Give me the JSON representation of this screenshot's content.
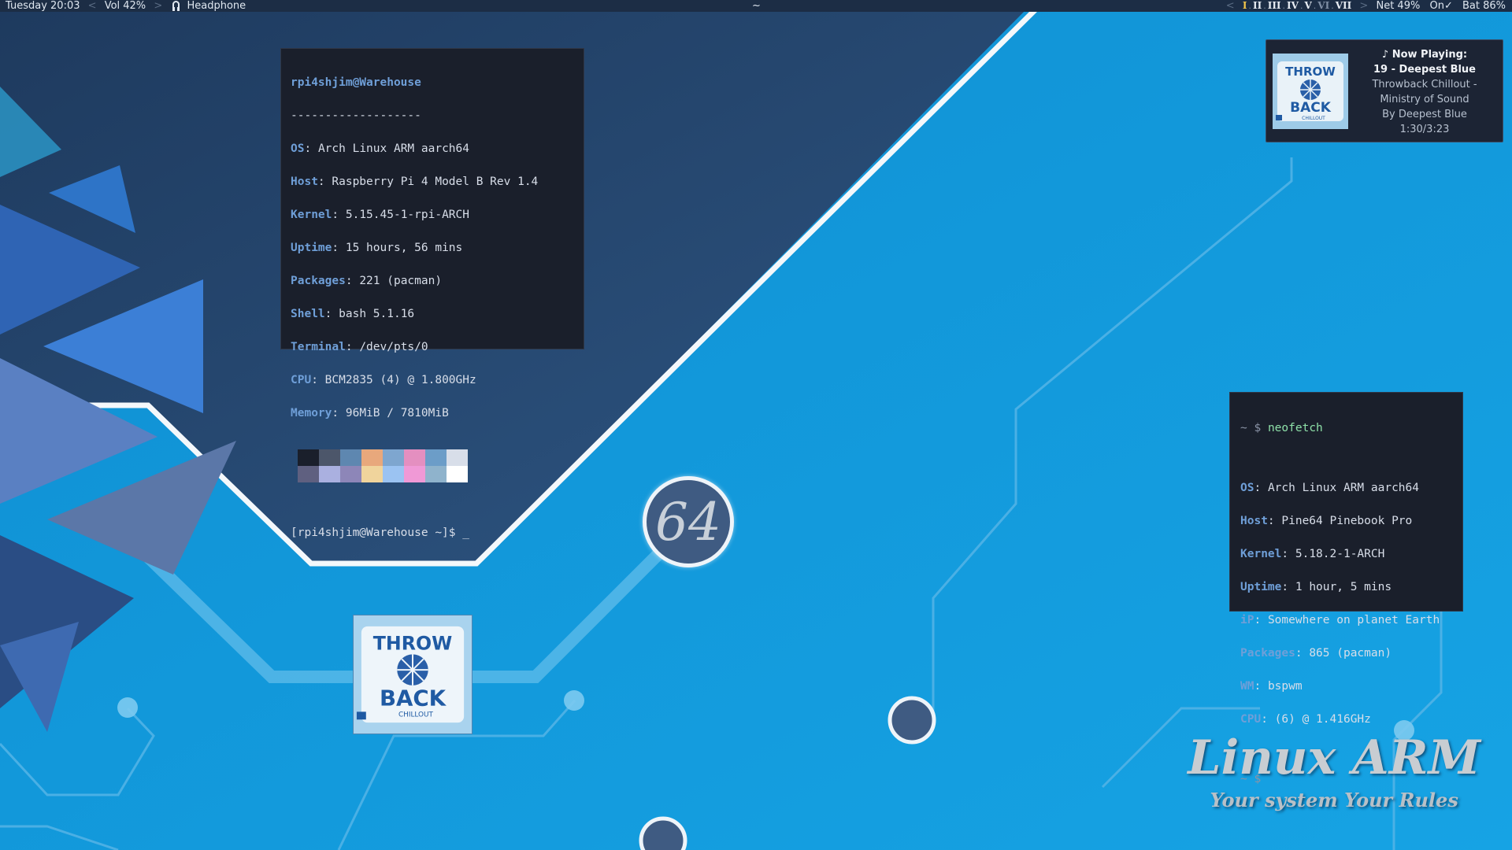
{
  "topbar": {
    "day": "Tuesday",
    "time": "20:03",
    "volume": "Vol 42%",
    "audio_device": "Headphone",
    "center_title": "~",
    "workspaces": [
      "I",
      "II",
      "III",
      "IV",
      "V",
      "VI",
      "VII"
    ],
    "active_workspace": "I",
    "network": "Net 49%",
    "status": "On✓",
    "battery": "Bat 86%"
  },
  "terminal_left": {
    "user_host": "rpi4shjim@Warehouse",
    "divider": "-------------------",
    "rows": [
      {
        "key": "OS",
        "value": "Arch Linux ARM aarch64"
      },
      {
        "key": "Host",
        "value": "Raspberry Pi 4 Model B Rev 1.4"
      },
      {
        "key": "Kernel",
        "value": "5.15.45-1-rpi-ARCH"
      },
      {
        "key": "Uptime",
        "value": "15 hours, 56 mins"
      },
      {
        "key": "Packages",
        "value": "221 (pacman)"
      },
      {
        "key": "Shell",
        "value": "bash 5.1.16"
      },
      {
        "key": "Terminal",
        "value": "/dev/pts/0"
      },
      {
        "key": "CPU",
        "value": "BCM2835 (4) @ 1.800GHz"
      },
      {
        "key": "Memory",
        "value": "96MiB / 7810MiB"
      }
    ],
    "palette_top": [
      "#1a1f2b",
      "#4c566a",
      "#5e87b0",
      "#e8a87c",
      "#7ea6cf",
      "#e48fc0",
      "#6c9dc8",
      "#d8dee9"
    ],
    "palette_bottom": [
      "#5f6080",
      "#aab0e0",
      "#8d86b8",
      "#f0d49c",
      "#9bc3f2",
      "#f099d6",
      "#8fb3cc",
      "#ffffff"
    ],
    "prompt": "[rpi4shjim@Warehouse ~]$ _"
  },
  "terminal_right": {
    "prompt_symbol": "~ $",
    "command": "neofetch",
    "rows": [
      {
        "key": "OS",
        "value": "Arch Linux ARM aarch64"
      },
      {
        "key": "Host",
        "value": "Pine64 Pinebook Pro"
      },
      {
        "key": "Kernel",
        "value": "5.18.2-1-ARCH"
      },
      {
        "key": "Uptime",
        "value": "1 hour, 5 mins"
      },
      {
        "key": "iP",
        "value": "Somewhere on planet Earth"
      },
      {
        "key": "Packages",
        "value": "865 (pacman)"
      },
      {
        "key": "WM",
        "value": "bspwm"
      },
      {
        "key": "CPU",
        "value": "(6) @ 1.416GHz"
      }
    ],
    "final_prompt": "~ $"
  },
  "now_playing": {
    "heading": "♪ Now Playing:",
    "title": "19 - Deepest Blue",
    "album_line1": "Throwback Chillout -",
    "album_line2": "Ministry of Sound",
    "artist": "By Deepest Blue",
    "position": "1:30/3:23"
  },
  "album_art": {
    "line1": "THROW",
    "line2": "BACK",
    "line3": "CHILLOUT"
  },
  "badge": "64",
  "branding": {
    "title": "Linux ARM",
    "subtitle": "Your system Your Rules"
  },
  "colors": {
    "bar_bg": "#1c2d45",
    "accent_blue": "#6f9fd8",
    "workspace_active": "#f2c54a",
    "wallpaper_light": "#169ad8",
    "wallpaper_dark": "#274a72"
  }
}
